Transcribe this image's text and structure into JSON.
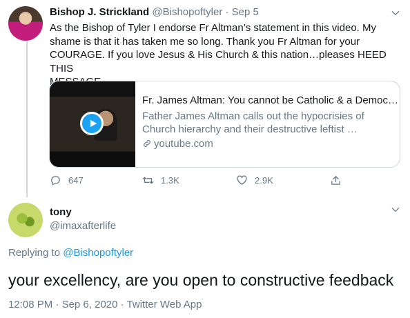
{
  "tweet1": {
    "display_name": "Bishop J. Strickland",
    "handle": "@Bishopoftyler",
    "separator": "·",
    "date": "Sep 5",
    "text_lines": [
      "As the Bishop of Tyler I endorse Fr Altman’s statement in this video. My",
      "shame is that it has taken me so long.  Thank you Fr Altman for your",
      "COURAGE. If you love Jesus & His Church & this nation…pleases HEED THIS",
      "MESSAGE"
    ],
    "card": {
      "title": "Fr. James Altman: You cannot be Catholic & a Democ…",
      "description_lines": [
        "Father James Altman calls out the hypocrisies of",
        "Church hierarchy and their destructive leftist …"
      ],
      "domain": "youtube.com"
    },
    "actions": {
      "reply_count": "647",
      "retweet_count": "1.3K",
      "like_count": "2.9K"
    }
  },
  "tweet2": {
    "display_name": "tony",
    "handle": "@imaxafterlife",
    "replying_prefix": "Replying to",
    "replying_to": "@Bishopoftyler",
    "text": "your excellency, are you open to constructive feedback",
    "time": "12:08 PM",
    "date": "Sep 6, 2020",
    "source": "Twitter Web App",
    "meta_separator": "·"
  },
  "colors": {
    "text": "#14171a",
    "muted": "#657786",
    "link": "#1b95e0",
    "accent": "#1da1f2",
    "border": "#ccd6dd"
  },
  "icons": [
    "reply-icon",
    "retweet-icon",
    "like-icon",
    "share-icon",
    "chevron-down-icon",
    "link-icon",
    "play-icon"
  ]
}
